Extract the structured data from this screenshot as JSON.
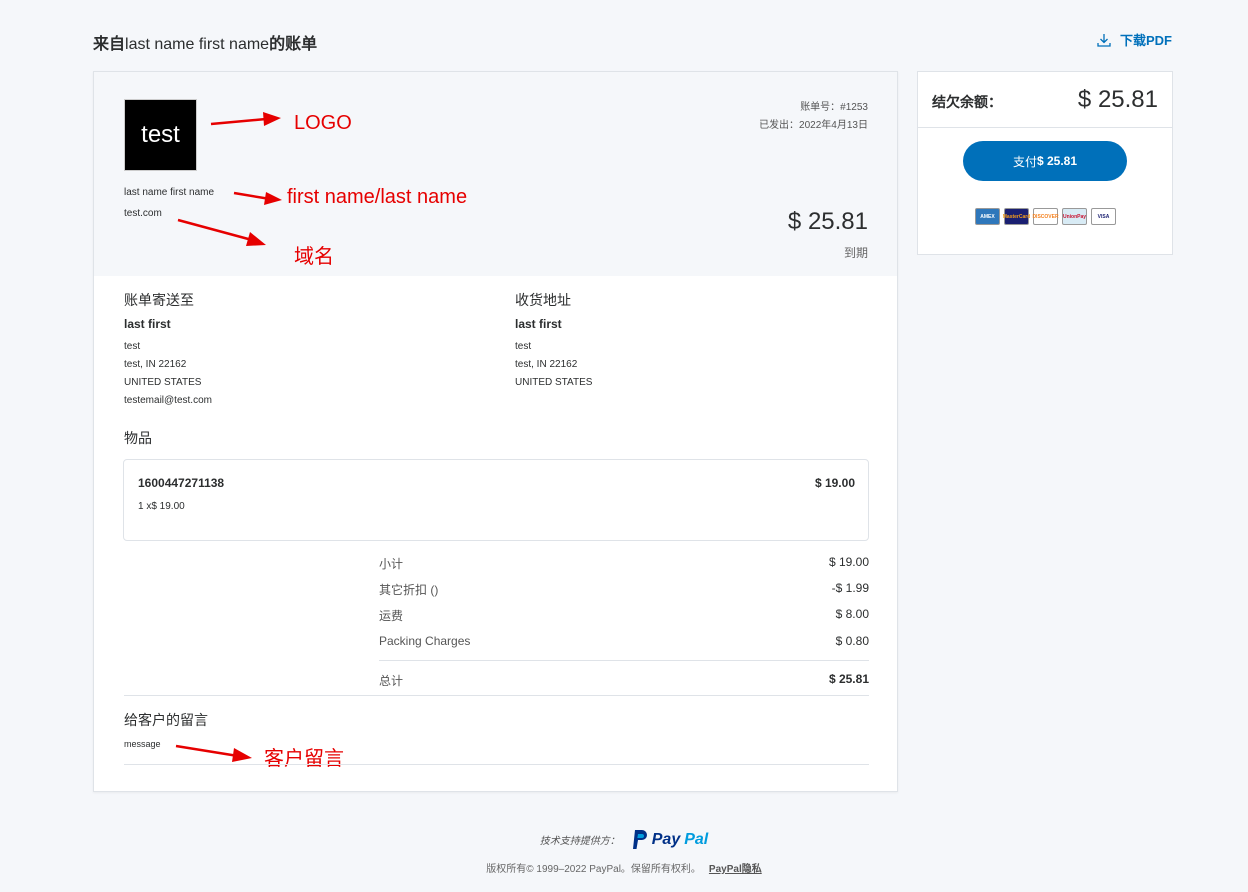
{
  "header": {
    "title_prefix": "来自",
    "title_name": "last name first name",
    "title_suffix": "的账单",
    "download_label": "下载PDF"
  },
  "invoice": {
    "logo_text": "test",
    "seller_name": "last name first name",
    "seller_domain": "test.com",
    "number_label": "账单号：#1253",
    "issued_label": "已发出：2022年4月13日",
    "amount": "$ 25.81",
    "due_label": "到期",
    "bill_to": {
      "heading": "账单寄送至",
      "name": "last first",
      "lines": [
        "test",
        "test, IN 22162",
        "UNITED STATES",
        "testemail@test.com"
      ]
    },
    "ship_to": {
      "heading": "收货地址",
      "name": "last first",
      "lines": [
        "test",
        "test, IN 22162",
        "UNITED STATES"
      ]
    },
    "items_heading": "物品",
    "items": [
      {
        "id": "1600447271138",
        "qty": "1 x$ 19.00",
        "price": "$ 19.00"
      }
    ],
    "summary": [
      {
        "label": "小计",
        "value": "$ 19.00"
      },
      {
        "label": "其它折扣 ()",
        "value": "-$ 1.99"
      },
      {
        "label": "运费",
        "value": "$ 8.00"
      },
      {
        "label": "Packing Charges",
        "value": "$ 0.80"
      }
    ],
    "total": {
      "label": "总计",
      "value": "$ 25.81"
    },
    "message_heading": "给客户的留言",
    "message": "message"
  },
  "annotations": {
    "logo": "LOGO",
    "name": "first name/last name",
    "domain": "域名",
    "message": "客户留言",
    "color": "#e60000"
  },
  "sidebar": {
    "balance_label": "结欠余额：",
    "balance_amount": "$ 25.81",
    "pay_prefix": "支付",
    "pay_amount": "$ 25.81",
    "cards": [
      "AMEX",
      "MasterCard",
      "DISCOVER",
      "UnionPay",
      "VISA"
    ]
  },
  "footer": {
    "tech_label": "技术支持提供方：",
    "brand_pay": "Pay",
    "brand_pal": "Pal",
    "copyright": "版权所有© 1999–2022 PayPal。保留所有权利。",
    "privacy_link": "PayPal隐私"
  },
  "colors": {
    "accent": "#0070ba",
    "background": "#f5f7fa",
    "paypal_dark": "#003087",
    "paypal_light": "#009cde"
  }
}
